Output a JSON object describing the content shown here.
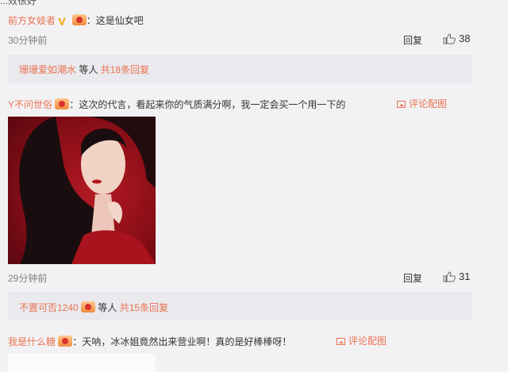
{
  "top_partial": {
    "text": "...效很好"
  },
  "comments": [
    {
      "user": "前方女妓者",
      "text": "这是仙女吧",
      "time": "30分钟前",
      "reply_label": "回复",
      "likes": "38",
      "reply_summary": {
        "user": "珊珊爱如潮水",
        "extra": "等人",
        "total": "共18条回复"
      }
    },
    {
      "user": "Y不问世俗",
      "text": "这次的代言，看起来你的气质满分啊，我一定会买一个用一下的",
      "pic_link": "评论配图",
      "time": "29分钟前",
      "reply_label": "回复",
      "likes": "31",
      "reply_summary": {
        "user": "不置可否1240",
        "extra": "等人",
        "total": "共15条回复"
      }
    },
    {
      "user": "我是什么糖",
      "text": "天呐，冰冰姐竟然出来营业啊！真的是好棒棒呀！",
      "pic_link": "评论配图"
    }
  ],
  "colors": {
    "accent": "#eb7350",
    "background": "#f2f2f5",
    "reply_box": "#e9e9ee"
  }
}
